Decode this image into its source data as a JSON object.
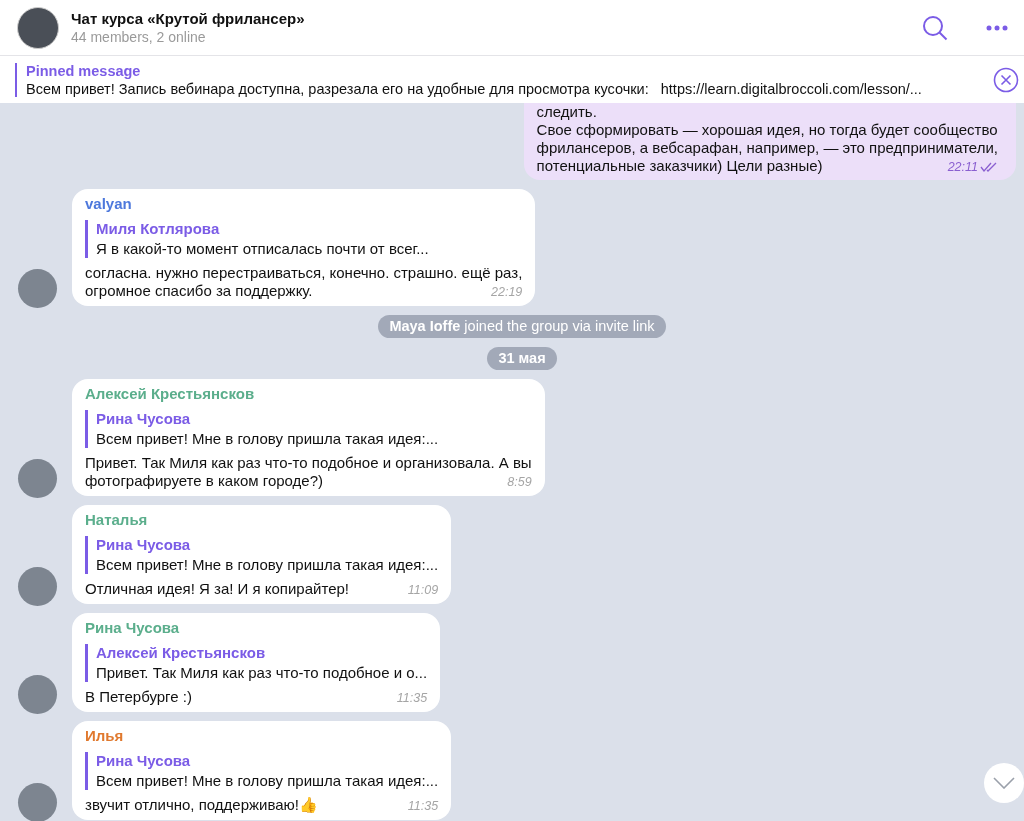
{
  "header": {
    "title": "Чат курса «Крутой фрилансер»",
    "subtitle": "44 members, 2 online"
  },
  "pinned": {
    "label": "Pinned message",
    "text": "Всем привет! Запись вебинара доступна, разрезала его на удобные для просмотра кусочки:   https://learn.digitalbroccoli.com/lesson/..."
  },
  "messages": [
    {
      "kind": "outgoing",
      "lines": [
        "следить.",
        "Свое сформировать — хорошая идея, но тогда будет сообщество",
        "фрилансеров, а вебсарафан, например, — это предприниматели,",
        "потенциальные заказчики) Цели разные)"
      ],
      "time": "22:11",
      "read": true
    },
    {
      "kind": "incoming",
      "sender": "valyan",
      "color": "#4d78dc",
      "reply": {
        "author": "Миля Котлярова",
        "text": "Я в какой-то момент отписалась почти от всег..."
      },
      "lines": [
        "согласна. нужно перестраиваться, конечно. страшно. ещё раз,",
        "огромное спасибо за поддержку."
      ],
      "time": "22:19"
    },
    {
      "kind": "service",
      "text": "**Maya Ioffe** joined the group via invite link"
    },
    {
      "kind": "date",
      "text": "31 мая"
    },
    {
      "kind": "incoming",
      "sender": "Алексей Крестьянсков",
      "color": "#5bae8c",
      "reply": {
        "author": "Рина Чусова",
        "text": "Всем привет! Мне в голову пришла такая идея:..."
      },
      "lines": [
        "Привет. Так Миля как раз что-то подобное и организовала. А вы",
        "фотографируете в каком городе?)"
      ],
      "time": "8:59"
    },
    {
      "kind": "incoming",
      "sender": "Наталья",
      "color": "#5bae8c",
      "reply": {
        "author": "Рина Чусова",
        "text": "Всем привет! Мне в голову пришла такая идея:..."
      },
      "lines": [
        "Отличная идея! Я за! И я копирайтер!"
      ],
      "time": "11:09"
    },
    {
      "kind": "incoming",
      "sender": "Рина Чусова",
      "color": "#5bae8c",
      "reply": {
        "author": "Алексей Крестьянсков",
        "text": "Привет. Так Миля как раз что-то подобное и о..."
      },
      "lines": [
        "В Петербурге :)"
      ],
      "time": "11:35"
    },
    {
      "kind": "incoming",
      "sender": "Илья",
      "color": "#e0792e",
      "reply": {
        "author": "Рина Чусова",
        "text": "Всем привет! Мне в голову пришла такая идея:..."
      },
      "lines": [
        "звучит отлично, поддерживаю!👍"
      ],
      "time": "11:35"
    }
  ]
}
